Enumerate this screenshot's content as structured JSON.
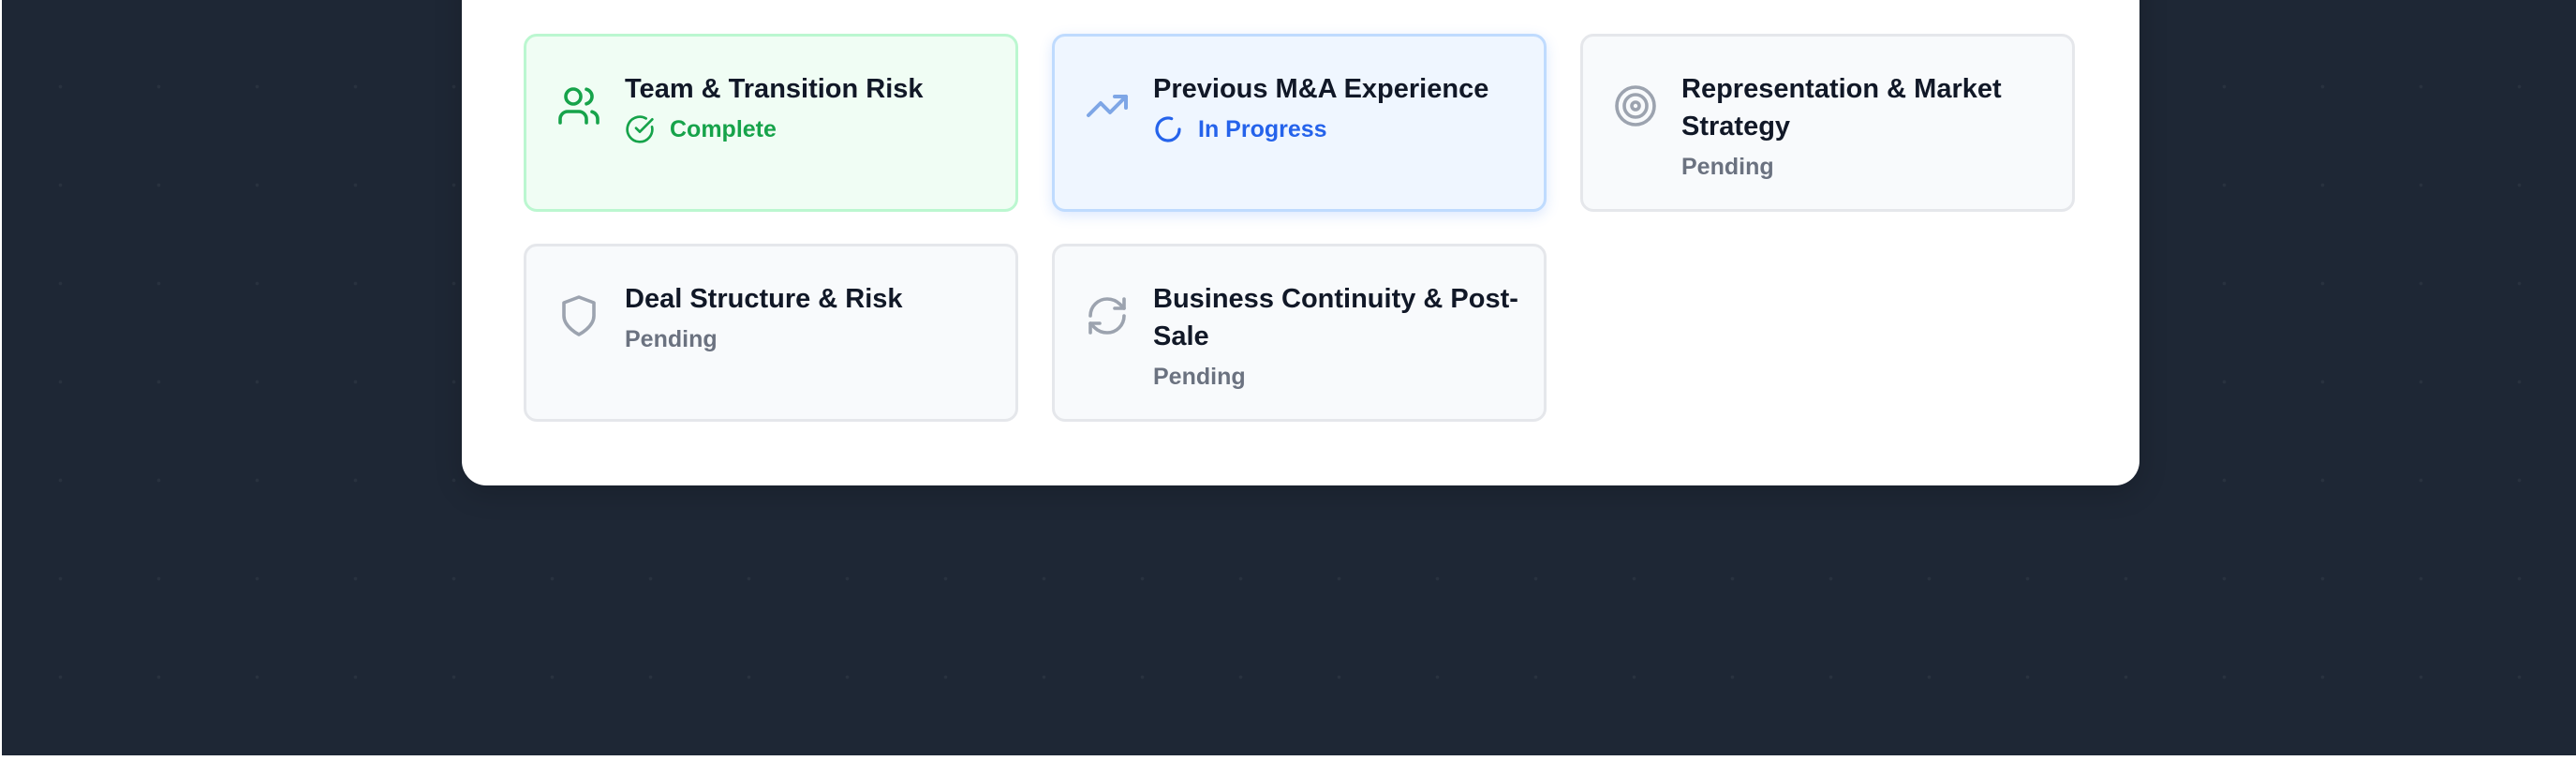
{
  "cards": [
    {
      "title": "Team & Transition Risk",
      "status": "Complete",
      "icon": "users-icon"
    },
    {
      "title": "Previous M&A Experience",
      "status": "In Progress",
      "icon": "trending-up-icon"
    },
    {
      "title": "Representation & Market Strategy",
      "status": "Pending",
      "icon": "target-icon"
    },
    {
      "title": "Deal Structure & Risk",
      "status": "Pending",
      "icon": "shield-icon"
    },
    {
      "title": "Business Continuity & Post-Sale",
      "status": "Pending",
      "icon": "refresh-icon"
    }
  ],
  "colors": {
    "background": "#1e2735",
    "complete": "#16a34a",
    "in_progress": "#2563eb",
    "pending": "#6b7280"
  }
}
